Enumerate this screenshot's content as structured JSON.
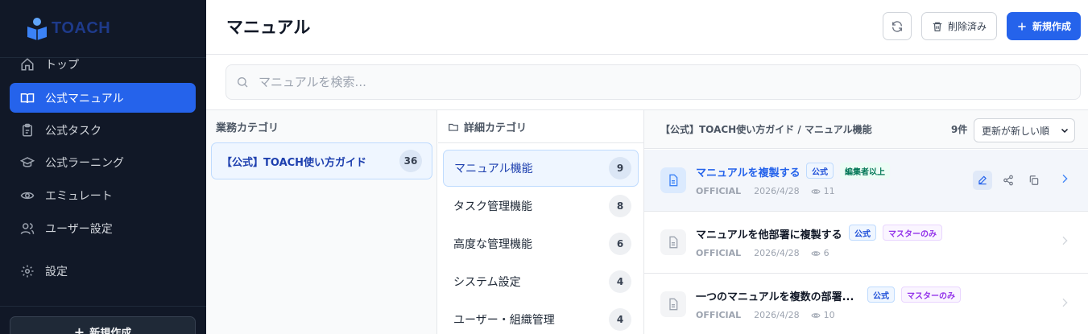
{
  "brand": {
    "name": "TOACH"
  },
  "sidebar": {
    "items": [
      {
        "label": "トップ",
        "icon": "home-icon"
      },
      {
        "label": "公式マニュアル",
        "icon": "book-icon",
        "active": true
      },
      {
        "label": "公式タスク",
        "icon": "clipboard-icon"
      },
      {
        "label": "公式ラーニング",
        "icon": "graduation-cap-icon"
      },
      {
        "label": "エミュレート",
        "icon": "eye-icon"
      },
      {
        "label": "ユーザー設定",
        "icon": "users-icon"
      },
      {
        "label": "設定",
        "icon": "gear-icon"
      }
    ],
    "new_button": "新規作成"
  },
  "header": {
    "title": "マニュアル",
    "deleted_label": "削除済み",
    "new_label": "新規作成"
  },
  "search": {
    "placeholder": "マニュアルを検索..."
  },
  "business_categories": {
    "heading": "業務カテゴリ",
    "items": [
      {
        "label": "【公式】TOACH使い方ガイド",
        "count": "36"
      }
    ]
  },
  "detail_categories": {
    "heading": "詳細カテゴリ",
    "items": [
      {
        "label": "マニュアル機能",
        "count": "9",
        "active": true
      },
      {
        "label": "タスク管理機能",
        "count": "8"
      },
      {
        "label": "高度な管理機能",
        "count": "6"
      },
      {
        "label": "システム設定",
        "count": "4"
      },
      {
        "label": "ユーザー・組織管理",
        "count": "4"
      }
    ]
  },
  "results": {
    "breadcrumb": "【公式】TOACH使い方ガイド / マニュアル機能",
    "count": "9件",
    "sort": "更新が新しい順",
    "items": [
      {
        "title": "マニュアルを複製する",
        "badges": [
          "公式",
          "編集者以上"
        ],
        "source": "OFFICIAL",
        "date": "2026/4/28",
        "views": "11"
      },
      {
        "title": "マニュアルを他部署に複製する",
        "badges": [
          "公式",
          "マスターのみ"
        ],
        "source": "OFFICIAL",
        "date": "2026/4/28",
        "views": "6"
      },
      {
        "title": "一つのマニュアルを複数の部署...",
        "badges": [
          "公式",
          "マスターのみ"
        ],
        "source": "OFFICIAL",
        "date": "2026/4/28",
        "views": "10"
      }
    ]
  },
  "colors": {
    "accent": "#2563eb",
    "sidebar_bg": "#111827"
  }
}
